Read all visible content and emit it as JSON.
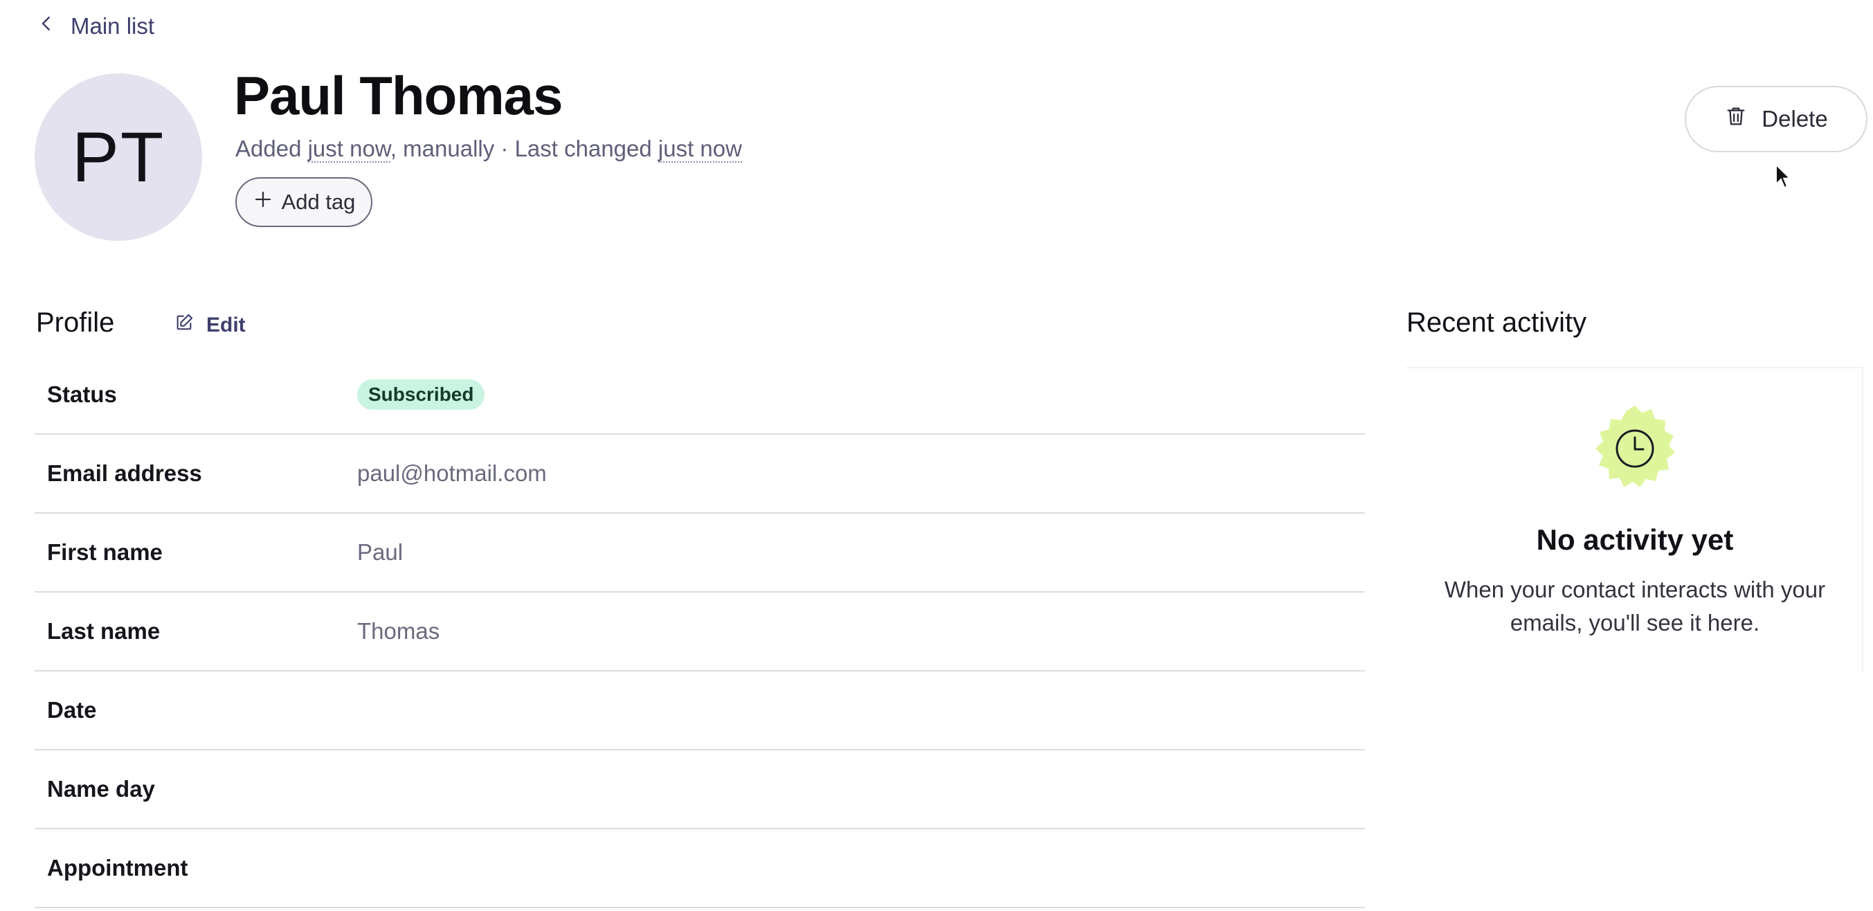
{
  "back_link": {
    "label": "Main list",
    "icon": "chevron-left-icon"
  },
  "contact": {
    "initials": "PT",
    "name": "Paul Thomas",
    "meta": {
      "added_prefix": "Added ",
      "added_when": "just now",
      "added_suffix": ", manually · Last changed ",
      "changed_when": "just now"
    }
  },
  "actions": {
    "add_tag_label": "Add tag",
    "delete_label": "Delete"
  },
  "profile": {
    "title": "Profile",
    "edit_label": "Edit",
    "rows": [
      {
        "label": "Status",
        "value": "Subscribed",
        "type": "badge"
      },
      {
        "label": "Email address",
        "value": "paul@hotmail.com"
      },
      {
        "label": "First name",
        "value": "Paul"
      },
      {
        "label": "Last name",
        "value": "Thomas"
      },
      {
        "label": "Date",
        "value": ""
      },
      {
        "label": "Name day",
        "value": ""
      },
      {
        "label": "Appointment",
        "value": ""
      }
    ]
  },
  "activity": {
    "title": "Recent activity",
    "empty_title": "No activity yet",
    "empty_text": "When your contact interacts with your emails, you'll see it here.",
    "icon": "clock-icon"
  },
  "colors": {
    "accent": "#3f3f6e",
    "avatar_bg": "#e4e2ee",
    "status_badge_bg": "#c9f4e1",
    "activity_badge_bg": "#dff59c"
  }
}
